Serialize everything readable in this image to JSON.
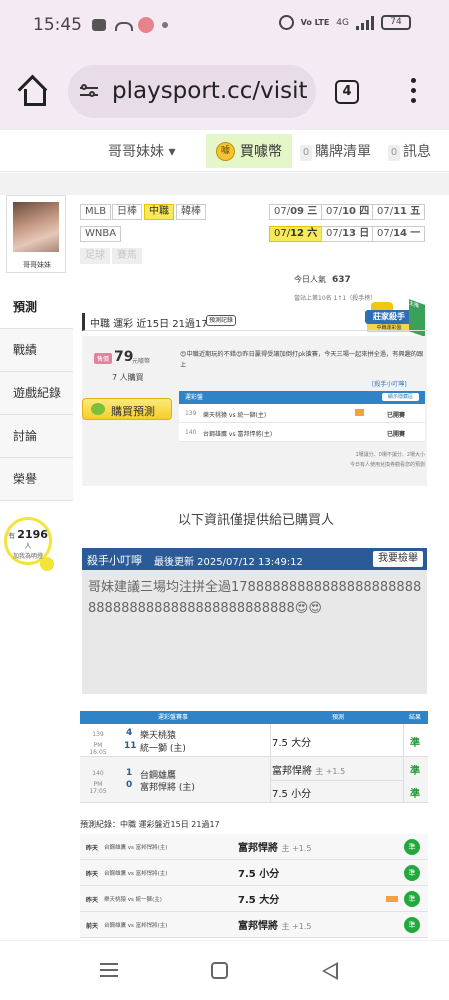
{
  "status_bar": {
    "time": "15:45",
    "battery": "74",
    "network": "4G",
    "volte": "Vo LTE"
  },
  "browser": {
    "url": "playsport.cc/visit",
    "tab_count": "4"
  },
  "site_nav": {
    "user_dropdown": "哥哥妹妹 ▾",
    "coin_label": "買噱幣",
    "coin_icon_text": "噱",
    "purchase_list_count": "0",
    "purchase_list_label": "購牌清單",
    "messages_count": "0",
    "messages_label": "訊息"
  },
  "profile": {
    "name": "哥哥妹妹",
    "menu": [
      "預測",
      "戰績",
      "遊戲紀錄",
      "討論",
      "榮譽"
    ],
    "active_menu": "預測",
    "bulb_prefix": "有",
    "bulb_count": "2196",
    "bulb_suffix": "人",
    "bulb_caption": "加我為明燈"
  },
  "leagues": {
    "row1": [
      "MLB",
      "日棒",
      "中職",
      "韓棒"
    ],
    "row2": [
      "WNBA"
    ],
    "row3": [
      "足球",
      "賽馬"
    ],
    "active": "中職"
  },
  "dates": {
    "row1": [
      {
        "prefix": "07/",
        "day": "09",
        "weekday": "三"
      },
      {
        "prefix": "07/",
        "day": "10",
        "weekday": "四"
      },
      {
        "prefix": "07/",
        "day": "11",
        "weekday": "五"
      }
    ],
    "row2": [
      {
        "prefix": "07/",
        "day": "12",
        "weekday": "六"
      },
      {
        "prefix": "07/",
        "day": "13",
        "weekday": "日"
      },
      {
        "prefix": "07/",
        "day": "14",
        "weekday": "一"
      }
    ]
  },
  "stats": {
    "popularity_label": "今日人氣",
    "popularity_value": "637",
    "rank_text": "當站上第10名 1↑1（殺手榜）"
  },
  "badge": {
    "ribbon": "莊家殺手",
    "sub": "中職運彩盤",
    "tag": "主推"
  },
  "section": {
    "title": "中職 運彩 近15日 21過17",
    "record_tag": "預測記錄"
  },
  "prediction": {
    "price_tag": "售價",
    "price": "79",
    "price_unit": "元噱幣",
    "buyers": "7 人購買",
    "buy_button": "購買預測",
    "description": "😍中職近期玩的不錯😍昨日贏得受讓加倒打pk搶賽，今天三場一起來拼全過，有興趣的跟上",
    "link_text": "[殺手小叮嚀]",
    "table_head": "運彩盤",
    "show_button": "顯示隱藏區",
    "rows": [
      {
        "id": "139",
        "match": "樂天桃猿 vs 統一獅(主)",
        "status": "已開賽"
      },
      {
        "id": "140",
        "match": "台鋼雄鷹 vs 富邦悍將(主)",
        "status": "已開賽"
      }
    ],
    "footer1": "1場讓分、0場不讓分、2場大小",
    "footer2": "今日有人使用兌換券觀看您的預測"
  },
  "info_line": "以下資訊僅提供給已購買人",
  "kill_note": {
    "title": "殺手小叮嚀",
    "updated": "最後更新 2025/07/12 13:49:12",
    "report_button": "我要檢舉",
    "text": "哥妹建議三場均注拼全過178888888888888888888888888888888888888888888888😍😍"
  },
  "pick_table": {
    "headers": {
      "board": "運彩盤賽事",
      "pick": "預測",
      "result": "結果"
    },
    "games": [
      {
        "id": "139",
        "time": "PM 16:05",
        "away_score": "4",
        "away_team": "樂天桃猿",
        "home_score": "11",
        "home_team": "統一獅",
        "home_tag": "(主)",
        "picks": [
          {
            "text": "7.5 大分",
            "extra": "",
            "result": "準"
          }
        ]
      },
      {
        "id": "140",
        "time": "PM 17:05",
        "away_score": "1",
        "away_team": "台鋼雄鷹",
        "home_score": "0",
        "home_team": "富邦悍將",
        "home_tag": "(主)",
        "picks": [
          {
            "text": "富邦悍將",
            "extra": "主 +1.5",
            "result": "準"
          },
          {
            "text": "7.5 小分",
            "extra": "",
            "result": "準"
          }
        ]
      }
    ]
  },
  "history": {
    "title": "預測紀錄：中職 運彩盤近15日 21過17",
    "rows": [
      {
        "day": "昨天",
        "match": "台鋼雄鷹 vs 富邦悍將(主)",
        "pick": "富邦悍將",
        "extra": "主 +1.5",
        "result": "準"
      },
      {
        "day": "昨天",
        "match": "台鋼雄鷹 vs 富邦悍將(主)",
        "pick": "7.5 小分",
        "extra": "",
        "result": "準"
      },
      {
        "day": "昨天",
        "match": "樂天桃猿 vs 統一獅(主)",
        "pick": "7.5 大分",
        "extra": "",
        "result": "準"
      },
      {
        "day": "前天",
        "match": "台鋼雄鷹 vs 富邦悍將(主)",
        "pick": "富邦悍將",
        "extra": "主 +1.5",
        "result": "準"
      }
    ]
  },
  "colors": {
    "accent_blue": "#2a5b96",
    "table_blue": "#2e84c6",
    "highlight_yellow": "#f8e95a",
    "win_green": "#22a83d",
    "browser_bar": "#f4eaf3"
  }
}
